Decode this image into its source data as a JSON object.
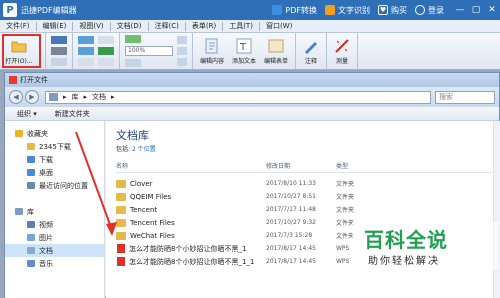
{
  "app": {
    "logo": "P",
    "title": "迅捷PDF编辑器",
    "right_items": [
      {
        "icon": "pdf-convert-icon",
        "label": "PDF转换",
        "color": "#3d8fe0"
      },
      {
        "icon": "ocr-icon",
        "label": "文字识别",
        "color": "#f0a020"
      },
      {
        "icon": "cart-icon",
        "label": "购买",
        "color": "#ffffff"
      },
      {
        "icon": "user-icon",
        "label": "登录",
        "color": "#ffffff"
      }
    ],
    "window_buttons": [
      "—",
      "▢",
      "✕"
    ]
  },
  "menubar": {
    "items": [
      "文件(F)",
      "编辑(E)",
      "视图(V)",
      "文档(D)",
      "注释(C)",
      "表单(R)",
      "工具(T)",
      "窗口(W)"
    ]
  },
  "ribbon": {
    "open_label": "打开(O)...",
    "zoom_value": "100%",
    "edit_content": "编辑内容",
    "add_text": "添加文本",
    "edit_form": "编辑表单",
    "annotate": "注释",
    "measure": "测量"
  },
  "dialog": {
    "title": "打开文件",
    "address": [
      "库",
      "▸",
      "文档",
      "▸"
    ],
    "search_placeholder": "搜索",
    "commands": [
      "组织 ▾",
      "新建文件夹"
    ],
    "nav": [
      {
        "label": "收藏夹",
        "level": 1,
        "icon": "star-icon",
        "color": "#e9b22c"
      },
      {
        "label": "2345下载",
        "level": 2,
        "icon": "download-folder-icon",
        "color": "#e7b94a"
      },
      {
        "label": "下载",
        "level": 2,
        "icon": "download-folder-icon",
        "color": "#4a88d8"
      },
      {
        "label": "桌面",
        "level": 2,
        "icon": "desktop-icon",
        "color": "#4a88d8"
      },
      {
        "label": "最近访问的位置",
        "level": 2,
        "icon": "recent-icon",
        "color": "#6a8ab0"
      },
      {
        "label": "",
        "level": 0,
        "icon": "",
        "color": ""
      },
      {
        "label": "库",
        "level": 1,
        "icon": "library-icon",
        "color": "#7c9cc6"
      },
      {
        "label": "视频",
        "level": 2,
        "icon": "video-icon",
        "color": "#5a7fb5"
      },
      {
        "label": "图片",
        "level": 2,
        "icon": "picture-icon",
        "color": "#6fa7d8"
      },
      {
        "label": "文档",
        "level": 2,
        "icon": "document-icon",
        "color": "#8ea8c8",
        "selected": true
      },
      {
        "label": "音乐",
        "level": 2,
        "icon": "music-icon",
        "color": "#5f8fc7"
      }
    ],
    "library_title": "文档库",
    "library_sub_prefix": "包括: ",
    "library_sub_link": "2 个位置",
    "columns": {
      "name": "名称",
      "date": "修改日期",
      "type": "类型"
    },
    "files": [
      {
        "name": "Clover",
        "date": "2017/8/10 11:33",
        "type": "文件夹",
        "kind": "folder"
      },
      {
        "name": "QQEIM Files",
        "date": "2017/10/27 8:51",
        "type": "文件夹",
        "kind": "folder"
      },
      {
        "name": "Tencent",
        "date": "2017/7/17 11:48",
        "type": "文件夹",
        "kind": "folder"
      },
      {
        "name": "Tencent Files",
        "date": "2017/10/27 9:32",
        "type": "文件夹",
        "kind": "folder"
      },
      {
        "name": "WeChat Files",
        "date": "2017/7/3 15:28",
        "type": "文件夹",
        "kind": "folder"
      },
      {
        "name": "怎么才能防晒8个小妙招让你晒不黑_1",
        "date": "2017/8/17 14:45",
        "type": "WPS",
        "kind": "pdf"
      },
      {
        "name": "怎么才能防晒8个小妙招让你晒不黑_1_1",
        "date": "2017/8/17 14:45",
        "type": "WPS",
        "kind": "pdf"
      }
    ]
  },
  "watermark": {
    "main": "百科全说",
    "sub": "助你轻松解决"
  }
}
